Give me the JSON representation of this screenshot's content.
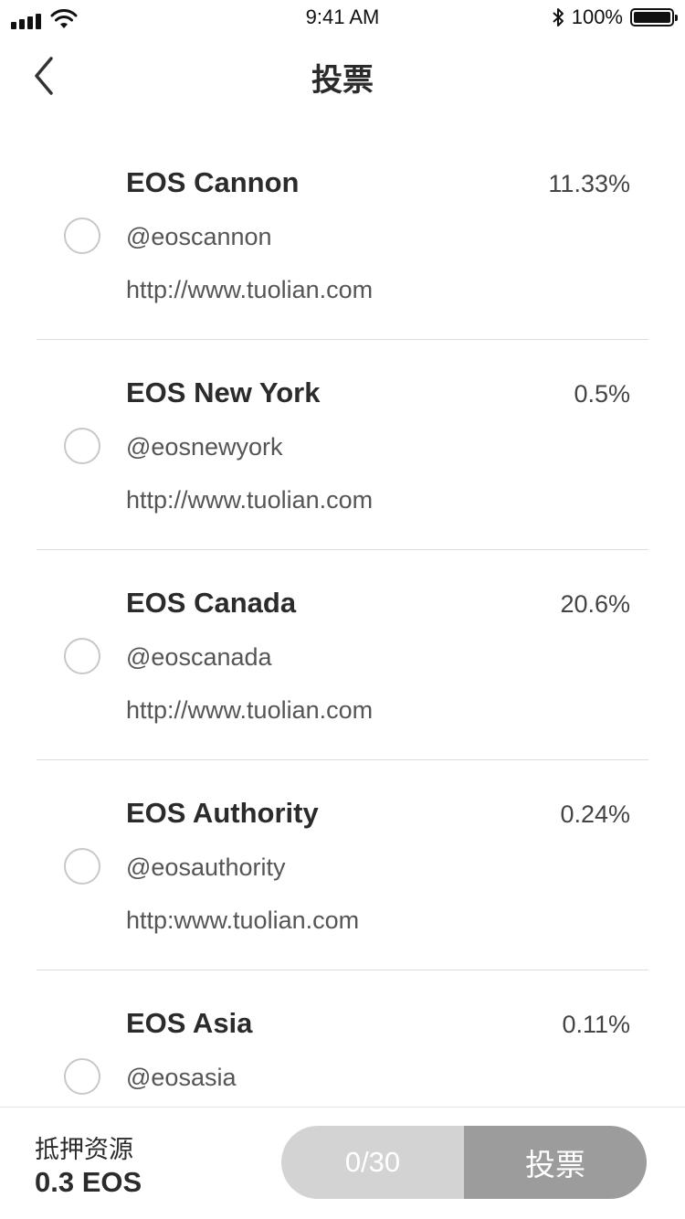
{
  "status_bar": {
    "time": "9:41 AM",
    "battery": "100%",
    "icons": [
      "signal-icon",
      "wifi-icon",
      "bluetooth-icon",
      "battery-icon"
    ]
  },
  "nav": {
    "title": "投票",
    "back_icon": "chevron-left-icon"
  },
  "producers": [
    {
      "name": "EOS Cannon",
      "account": "@eoscannon",
      "url": "http://www.tuolian.com",
      "percent": "11.33%"
    },
    {
      "name": "EOS New York",
      "account": "@eosnewyork",
      "url": "http://www.tuolian.com",
      "percent": "0.5%"
    },
    {
      "name": "EOS Canada",
      "account": "@eoscanada",
      "url": "http://www.tuolian.com",
      "percent": "20.6%"
    },
    {
      "name": "EOS Authority",
      "account": "@eosauthority",
      "url": "http:www.tuolian.com",
      "percent": "0.24%"
    },
    {
      "name": "EOS Asia",
      "account": "@eosasia",
      "url": "",
      "percent": "0.11%"
    }
  ],
  "bottom": {
    "stake_label": "抵押资源",
    "stake_value": "0.3 EOS",
    "vote_count": "0/30",
    "vote_button": "投票"
  },
  "colors": {
    "vote_count_bg": "#d3d3d3",
    "vote_button_bg": "#9c9c9c",
    "divider": "#dcdcdc"
  }
}
